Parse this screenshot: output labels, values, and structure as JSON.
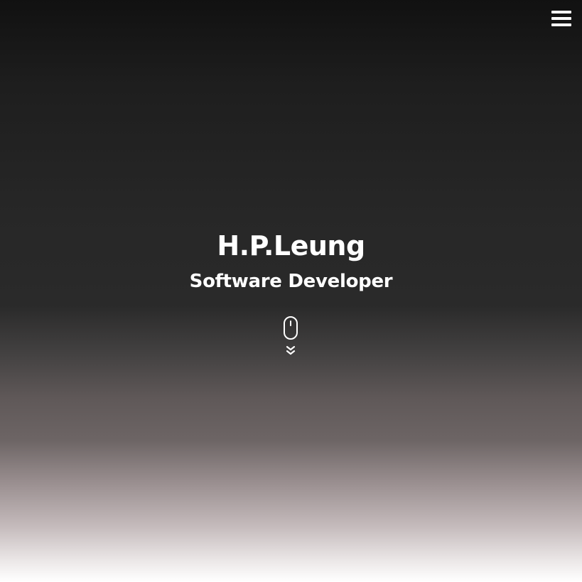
{
  "header": {
    "menu_icon": "hamburger-menu-icon"
  },
  "hero": {
    "name": "H.P.Leung",
    "role": "Software Developer"
  },
  "scroll": {
    "mouse_icon": "mouse-icon",
    "arrow_icon": "double-chevron-down-icon"
  },
  "colors": {
    "text": "#ffffff",
    "background_top": "#111111",
    "background_mid": "#2a2a2a",
    "background_bottom": "#ffffff"
  }
}
